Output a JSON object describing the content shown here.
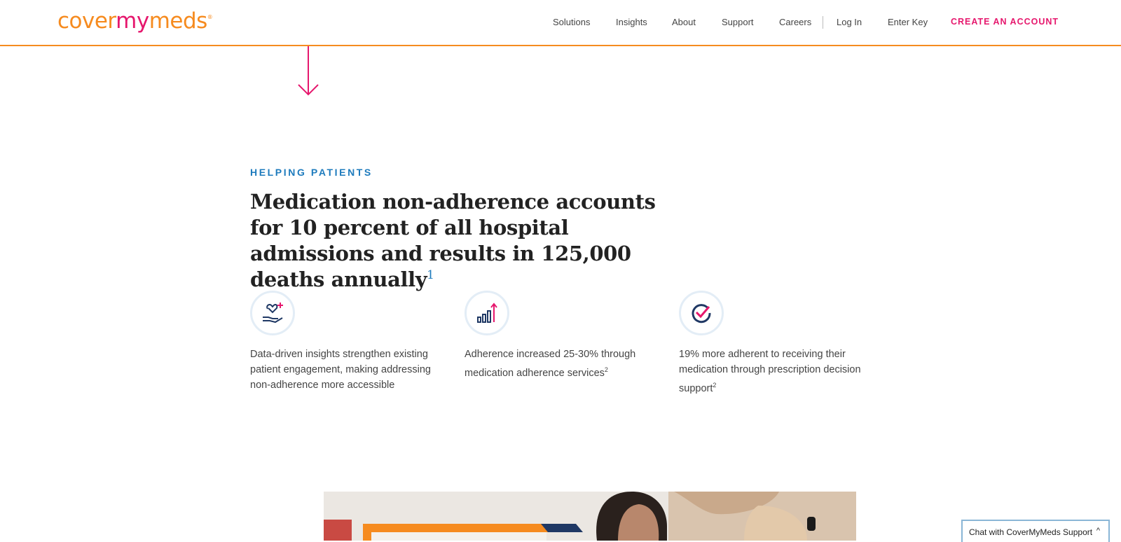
{
  "header": {
    "logo": {
      "part1": "cover",
      "part2": "my",
      "part3": "meds",
      "mark": "®"
    },
    "nav": [
      {
        "label": "Solutions"
      },
      {
        "label": "Insights"
      },
      {
        "label": "About"
      },
      {
        "label": "Support"
      },
      {
        "label": "Careers"
      },
      {
        "label": "Log In"
      },
      {
        "label": "Enter Key"
      }
    ],
    "cta": "CREATE AN ACCOUNT"
  },
  "section": {
    "eyebrow": "HELPING PATIENTS",
    "headline": "Medication non-adherence accounts for 10 percent of all hospital admissions and results in 125,000 deaths annually",
    "headline_footnote": "1",
    "features": [
      {
        "icon": "hand-heart-icon",
        "text": "Data-driven insights strengthen existing patient engagement, making addressing non-adherence more accessible",
        "footnote": ""
      },
      {
        "icon": "bar-chart-up-icon",
        "text": "Adherence increased 25-30% through medication adherence services",
        "footnote": "2"
      },
      {
        "icon": "check-circle-icon",
        "text": "19% more adherent to receiving their medication through prescription decision support",
        "footnote": "2"
      }
    ]
  },
  "chat": {
    "label": "Chat with CoverMyMeds Support",
    "caret": "^"
  },
  "colors": {
    "brand_orange": "#f68b1f",
    "brand_pink": "#e6176d",
    "brand_blue": "#1e7bbd",
    "navy": "#1f3864"
  }
}
